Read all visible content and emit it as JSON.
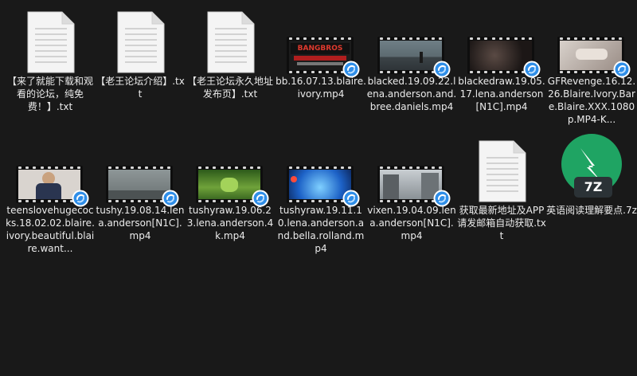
{
  "files": [
    {
      "name": "【来了就能下载和观看的论坛，纯免费！】.txt",
      "type": "txt"
    },
    {
      "name": "【老王论坛介绍】.txt",
      "type": "txt"
    },
    {
      "name": "【老王论坛永久地址发布页】.txt",
      "type": "txt"
    },
    {
      "name": "bb.16.07.13.blaire.ivory.mp4",
      "type": "video",
      "thumb": "banner"
    },
    {
      "name": "blacked.19.09.22.lena.anderson.and.bree.daniels.mp4",
      "type": "video",
      "thumb": "beach"
    },
    {
      "name": "blackedraw.19.05.17.lena.anderson[N1C].mp4",
      "type": "video",
      "thumb": "dark"
    },
    {
      "name": "GFRevenge.16.12.26.Blaire.Ivory.Bare.Blaire.XXX.1080p.MP4-K...",
      "type": "video",
      "thumb": "bed"
    },
    {
      "name": "teenslovehugecocks.18.02.02.blaire.ivory.beautiful.blaire.want...",
      "type": "video",
      "thumb": "person"
    },
    {
      "name": "tushy.19.08.14.lena.anderson[N1C].mp4",
      "type": "video",
      "thumb": "grey"
    },
    {
      "name": "tushyraw.19.06.23.lena.anderson.4k.mp4",
      "type": "video",
      "thumb": "green"
    },
    {
      "name": "tushyraw.19.11.10.lena.anderson.and.bella.rolland.mp4",
      "type": "video",
      "thumb": "blue"
    },
    {
      "name": "vixen.19.04.09.lena.anderson[N1C].mp4",
      "type": "video",
      "thumb": "street"
    },
    {
      "name": "获取最新地址及APP请发邮箱自动获取.txt",
      "type": "txt"
    },
    {
      "name": "英语阅读理解要点.7z",
      "type": "7z",
      "badge_text": "7Z"
    }
  ],
  "colors": {
    "background": "#191919",
    "label_text": "#ececec",
    "badge_blue": "#2f8ee8",
    "archive_green": "#1fa463",
    "archive_dark": "#2b3236"
  }
}
